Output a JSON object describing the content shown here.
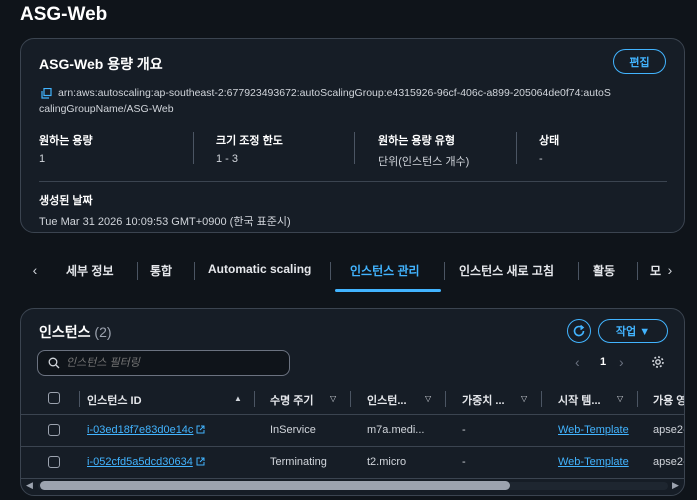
{
  "page": {
    "title": "ASG-Web"
  },
  "overview": {
    "title": "ASG-Web 용량 개요",
    "edit_label": "편집",
    "arn_line1": "arn:aws:autoscaling:ap-southeast-2:677923493672:autoScalingGroup:e4315926-96cf-406c-a899-205064de0f74:autoS",
    "arn_line2": "calingGroupName/ASG-Web",
    "stats": [
      {
        "label": "원하는 용량",
        "value": "1"
      },
      {
        "label": "크기 조정 한도",
        "value": "1 - 3"
      },
      {
        "label": "원하는 용량 유형",
        "value": "단위(인스턴스 개수)"
      },
      {
        "label": "상태",
        "value": "-"
      }
    ],
    "created_label": "생성된 날짜",
    "created_value": "Tue Mar 31 2026 10:09:53 GMT+0900 (한국 표준시)"
  },
  "tabs": {
    "prev_icon": "chevron-left-icon",
    "next_icon": "chevron-right-icon",
    "items": [
      {
        "label": "세부 정보"
      },
      {
        "label": "통합"
      },
      {
        "label": "Automatic scaling"
      },
      {
        "label": "인스턴스 관리",
        "active": true
      },
      {
        "label": "인스턴스 새로 고침"
      },
      {
        "label": "활동"
      },
      {
        "label": "모"
      }
    ]
  },
  "instances": {
    "title": "인스턴스",
    "count": "(2)",
    "action_label": "작업 ▼",
    "search_placeholder": "인스턴스 필터링",
    "page_number": "1",
    "columns": [
      {
        "label": "인스턴스 ID",
        "sort": "▲"
      },
      {
        "label": "수명 주기",
        "sort": "▽"
      },
      {
        "label": "인스턴...",
        "sort": "▽"
      },
      {
        "label": "가중치 ...",
        "sort": "▽"
      },
      {
        "label": "시작 템...",
        "sort": "▽"
      },
      {
        "label": "가용 영"
      }
    ],
    "rows": [
      {
        "id": "i-03ed18f7e83d0e14c",
        "lifecycle": "InService",
        "type": "m7a.medi...",
        "weight": "-",
        "template": "Web-Template",
        "az": "apse2-"
      },
      {
        "id": "i-052cfd5a5dcd30634",
        "lifecycle": "Terminating",
        "type": "t2.micro",
        "weight": "-",
        "template": "Web-Template",
        "az": "apse2-"
      }
    ]
  },
  "colors": {
    "accent": "#42b4ff",
    "background": "#0f141a",
    "card": "#161d26"
  }
}
